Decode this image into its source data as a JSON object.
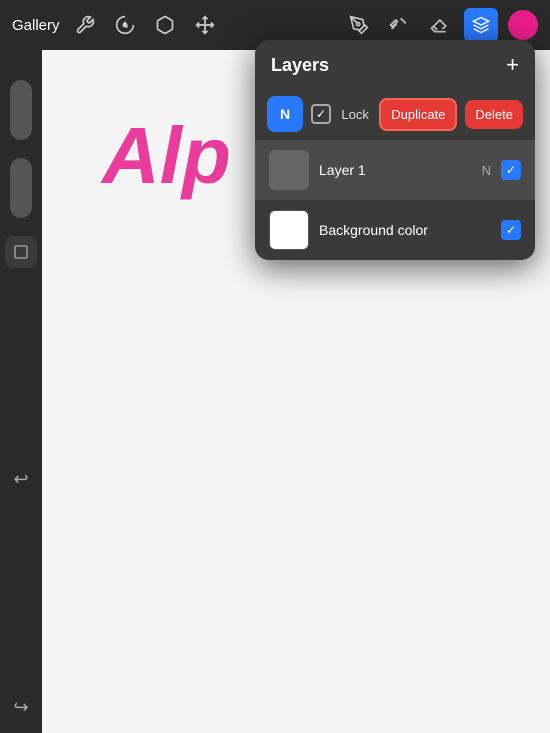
{
  "app": {
    "title": "Gallery"
  },
  "toolbar": {
    "gallery_label": "Gallery",
    "icons": [
      "wrench",
      "magic",
      "s-tool",
      "cursor"
    ],
    "right_icons": [
      "pen",
      "smudge",
      "eraser",
      "layers",
      "color"
    ]
  },
  "layers_panel": {
    "title": "Layers",
    "add_button": "+",
    "actions": {
      "n_label": "N",
      "lock_label": "Lock",
      "duplicate_label": "Duplicate",
      "delete_label": "Delete"
    },
    "layer1": {
      "name": "Layer 1",
      "mode": "N",
      "checked": true
    },
    "background": {
      "name": "Background color",
      "checked": true
    }
  },
  "canvas": {
    "text_preview": "Alp"
  },
  "sidebar": {
    "undo_label": "↩",
    "redo_label": "↪"
  }
}
